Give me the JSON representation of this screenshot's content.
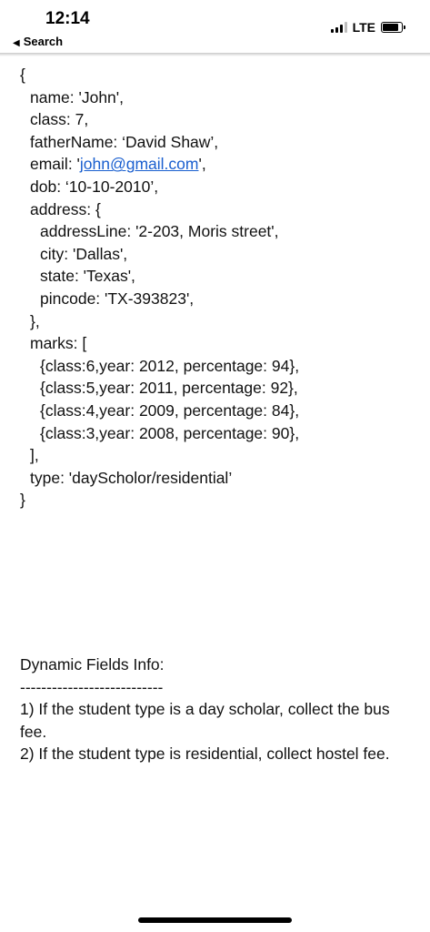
{
  "status_bar": {
    "time": "12:14",
    "back_label": "Search",
    "network": "LTE"
  },
  "code": {
    "open_brace": "{",
    "name": "name: 'John',",
    "class": "class: 7,",
    "father_name": "fatherName: ‘David Shaw’,",
    "email_prefix": "email: '",
    "email_link": "john@gmail.com",
    "email_suffix": "',",
    "dob": "dob: ‘10-10-2010’,",
    "address_open": "address: {",
    "address_line": "addressLine: '2-203, Moris street',",
    "city": "city: 'Dallas',",
    "state": "state: 'Texas',",
    "pincode": "pincode: 'TX-393823',",
    "address_close": "},",
    "marks_open": "marks: [",
    "marks": [
      "{class:6,year: 2012, percentage: 94},",
      "{class:5,year: 2011, percentage: 92},",
      "{class:4,year: 2009, percentage: 84},",
      "{class:3,year: 2008, percentage: 90},"
    ],
    "marks_close": "],",
    "type": "type: 'dayScholor/residential’",
    "close_brace": "}"
  },
  "info": {
    "title": "Dynamic Fields Info:",
    "separator": "---------------------------",
    "rule1": "1) If the student type is a day scholar, collect the bus fee.",
    "rule2": "2) If the student type is residential, collect hostel fee."
  }
}
